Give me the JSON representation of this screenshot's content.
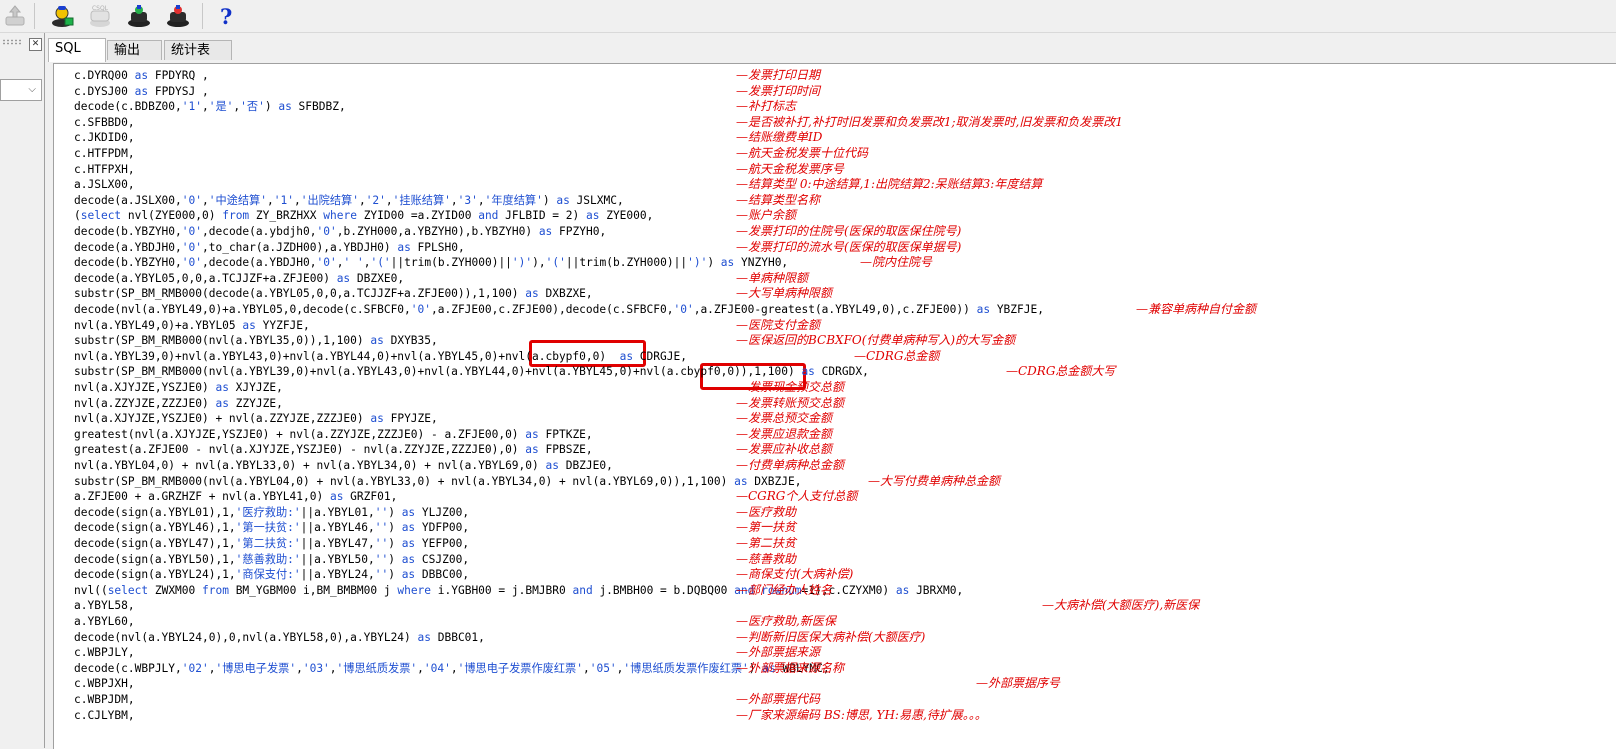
{
  "toolbar": {
    "buttons": [
      {
        "name": "export-icon",
        "state": "disabled"
      },
      {
        "name": "connect-user-icon",
        "state": "enabled"
      },
      {
        "name": "csql-icon",
        "label": "CSQL",
        "state": "disabled"
      },
      {
        "name": "run-query-icon",
        "state": "enabled"
      },
      {
        "name": "run-script-icon",
        "state": "enabled"
      }
    ],
    "help_label": "?"
  },
  "left_panel": {
    "close_glyph": "✕",
    "dropdown_chevron": "⌵"
  },
  "tabs": [
    {
      "label": "SQL",
      "active": true
    },
    {
      "label": "输出",
      "active": false
    },
    {
      "label": "统计表",
      "active": false
    }
  ],
  "code_lines": [
    {
      "code": "c.DYRQ00 as FPDYRQ ,",
      "comment": "—发票打印日期"
    },
    {
      "code": "c.DYSJ00 as FPDYSJ ,",
      "comment": "—发票打印时间"
    },
    {
      "code": "decode(c.BDBZ00,'1','是','否') as SFBDBZ,",
      "comment": "—补打标志"
    },
    {
      "code": "c.SFBBD0,",
      "comment": "—是否被补打,补打时旧发票和负发票改1;取消发票时,旧发票和负发票改1"
    },
    {
      "code": "c.JKDID0,",
      "comment": "—结账缴费单ID"
    },
    {
      "code": "c.HTFPDM,",
      "comment": "—航天金税发票十位代码"
    },
    {
      "code": "c.HTFPXH,",
      "comment": "—航天金税发票序号"
    },
    {
      "code": "a.JSLX00,",
      "comment": "—结算类型 0:中途结算,1:出院结算2:呆账结算3:年度结算"
    },
    {
      "code": "decode(a.JSLX00,'0','中途结算','1','出院结算','2','挂账结算','3','年度结算') as JSLXMC,",
      "comment": "—结算类型名称"
    },
    {
      "code": "(select nvl(ZYE000,0) from ZY_BRZHXX where ZYID00 =a.ZYID00 and JFLBID = 2) as ZYE000,",
      "comment": "—账户余额"
    },
    {
      "code": "decode(b.YBZYH0,'0',decode(a.ybdjh0,'0',b.ZYH000,a.YBZYH0),b.YBZYH0) as FPZYH0,",
      "comment": "—发票打印的住院号(医保的取医保住院号)"
    },
    {
      "code": "decode(a.YBDJH0,'0',to_char(a.JZDH00),a.YBDJH0) as FPLSH0,",
      "comment": "—发票打印的流水号(医保的取医保单据号)"
    },
    {
      "code": "decode(b.YBZYH0,'0',decode(a.YBDJH0,'0',' ','('||trim(b.ZYH000)||')'),'('||trim(b.ZYH000)||')') as YNZYH0,",
      "comment": "—院内住院号"
    },
    {
      "code": "decode(a.YBYL05,0,0,a.TCJJZF+a.ZFJE00) as DBZXE0,",
      "comment": "—单病种限额"
    },
    {
      "code": "substr(SP_BM_RMB000(decode(a.YBYL05,0,0,a.TCJJZF+a.ZFJE00)),1,100) as DXBZXE,",
      "comment": "—大写单病种限额"
    },
    {
      "code": "decode(nvl(a.YBYL49,0)+a.YBYL05,0,decode(c.SFBCF0,'0',a.ZFJE00,c.ZFJE00),decode(c.SFBCF0,'0',a.ZFJE00-greatest(a.YBYL49,0),c.ZFJE00)) as YBZFJE,",
      "comment": "—兼容单病种自付金额"
    },
    {
      "code": "nvl(a.YBYL49,0)+a.YBYL05 as YYZFJE,",
      "comment": "—医院支付金额"
    },
    {
      "code": "substr(SP_BM_RMB000(nvl(a.YBYL35,0)),1,100) as DXYB35,",
      "comment": "—医保返回的BCBXFO(付费单病种写入)的大写金额"
    },
    {
      "code": "nvl(a.YBYL39,0)+nvl(a.YBYL43,0)+nvl(a.YBYL44,0)+nvl(a.YBYL45,0)+nvl(a.cbypf0,0)  as CDRGJE,",
      "comment": "—CDRG总金额"
    },
    {
      "code": "substr(SP_BM_RMB000(nvl(a.YBYL39,0)+nvl(a.YBYL43,0)+nvl(a.YBYL44,0)+nvl(a.YBYL45,0)+nvl(a.cbypf0,0)),1,100) as CDRGDX,",
      "comment": "—CDRG总金额大写"
    },
    {
      "code": "nvl(a.XJYJZE,YSZJE0) as XJYJZE,",
      "comment": "—发票现金预交总额"
    },
    {
      "code": "nvl(a.ZZYJZE,ZZZJE0) as ZZYJZE,",
      "comment": "—发票转账预交总额"
    },
    {
      "code": "nvl(a.XJYJZE,YSZJE0) + nvl(a.ZZYJZE,ZZZJE0) as FPYJZE,",
      "comment": "—发票总预交金额"
    },
    {
      "code": "greatest(nvl(a.XJYJZE,YSZJE0) + nvl(a.ZZYJZE,ZZZJE0) - a.ZFJE00,0) as FPTKZE,",
      "comment": "—发票应退款金额"
    },
    {
      "code": "greatest(a.ZFJE00 - nvl(a.XJYJZE,YSZJE0) - nvl(a.ZZYJZE,ZZZJE0),0) as FPBSZE,",
      "comment": "—发票应补收总额"
    },
    {
      "code": "nvl(a.YBYL04,0) + nvl(a.YBYL33,0) + nvl(a.YBYL34,0) + nvl(a.YBYL69,0) as DBZJE0,",
      "comment": "—付费单病种总金额"
    },
    {
      "code": "substr(SP_BM_RMB000(nvl(a.YBYL04,0) + nvl(a.YBYL33,0) + nvl(a.YBYL34,0) + nvl(a.YBYL69,0)),1,100) as DXBZJE,",
      "comment": "—大写付费单病种总金额"
    },
    {
      "code": "a.ZFJE00 + a.GRZHZF + nvl(a.YBYL41,0) as GRZF01,",
      "comment": "—CGRG个人支付总额"
    },
    {
      "code": "decode(sign(a.YBYL01),1,'医疗救助:'||a.YBYL01,'') as YLJZ00,",
      "comment": "—医疗救助"
    },
    {
      "code": "decode(sign(a.YBYL46),1,'第一扶贫:'||a.YBYL46,'') as YDFP00,",
      "comment": "—第一扶贫"
    },
    {
      "code": "decode(sign(a.YBYL47),1,'第二扶贫:'||a.YBYL47,'') as YEFP00,",
      "comment": "—第二扶贫"
    },
    {
      "code": "decode(sign(a.YBYL50),1,'慈善救助:'||a.YBYL50,'') as CSJZ00,",
      "comment": "—慈善救助"
    },
    {
      "code": "decode(sign(a.YBYL24),1,'商保支付:'||a.YBYL24,'') as DBBC00,",
      "comment": "—商保支付(大病补偿)"
    },
    {
      "code": "nvl((select ZWXM00 from BM_YGBM00 i,BM_BMBM00 j where i.YGBH00 = j.BMJBR0 and j.BMBH00 = b.DQBQ00 and rownum=1),c.CZYXM0) as JBRXM0,",
      "comment": "—部门经办人姓名"
    },
    {
      "code": "a.YBYL58,",
      "comment": "—大病补偿(大额医疗),新医保"
    },
    {
      "code": "a.YBYL60,",
      "comment": "—医疗救助,新医保"
    },
    {
      "code": "decode(nvl(a.YBYL24,0),0,nvl(a.YBYL58,0),a.YBYL24) as DBBC01,",
      "comment": "—判断新旧医保大病补偿(大额医疗)"
    },
    {
      "code": "c.WBPJLY,",
      "comment": "—外部票据来源"
    },
    {
      "code": "decode(c.WBPJLY,'02','博思电子发票','03','博思纸质发票','04','博思电子发票作废红票','05','博思纸质发票作废红票') as WBLYMC,",
      "comment": "—外部票据来源名称"
    },
    {
      "code": "c.WBPJXH,",
      "comment": "—外部票据序号"
    },
    {
      "code": "c.WBPJDM,",
      "comment": "—外部票据代码"
    },
    {
      "code": "c.CJLYBM,",
      "comment": "—厂家来源编码 BS:博思, YH:易惠,待扩展。。。"
    }
  ],
  "colors": {
    "keyword": "#1f4fd1",
    "comment": "#e00000",
    "highlight_box": "#e00000"
  }
}
